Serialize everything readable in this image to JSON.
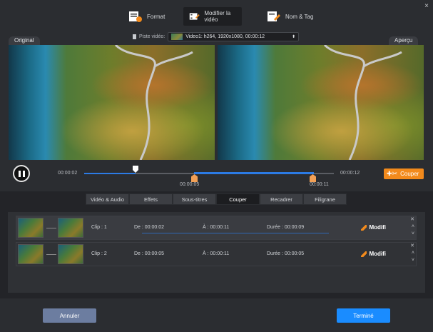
{
  "tabs": [
    {
      "label": "Format",
      "icon": "format-icon"
    },
    {
      "label": "Modifier la vidéo",
      "icon": "edit-video-icon"
    },
    {
      "label": "Nom & Tag",
      "icon": "tag-icon"
    }
  ],
  "close": "×",
  "panels": {
    "original": "Original",
    "preview": "Aperçu"
  },
  "track": {
    "label": "Piste vidéo:",
    "value": "Video1: h264, 1920x1080, 00:00:12"
  },
  "player": {
    "current_time": "00:00:02",
    "end_time": "00:00:12",
    "start_mark": "00:00:05",
    "end_mark": "00:00:11",
    "cut_label": "Couper"
  },
  "subtabs": [
    "Vidéo & Audio",
    "Effets",
    "Sous-titres",
    "Couper",
    "Recadrer",
    "Filigrane"
  ],
  "clips": [
    {
      "name": "Clip : 1",
      "from": "De :  00:00:02",
      "to": "À :  00:00:11",
      "duration": "Durée : 00:00:09",
      "action": "Modifi"
    },
    {
      "name": "Clip : 2",
      "from": "De :  00:00:05",
      "to": "À :  00:00:11",
      "duration": "Durée : 00:00:05",
      "action": "Modifi"
    }
  ],
  "footer": {
    "cancel": "Annuler",
    "done": "Terminé"
  },
  "colors": {
    "accent": "#1a8cff",
    "cut": "#f28a1c"
  }
}
